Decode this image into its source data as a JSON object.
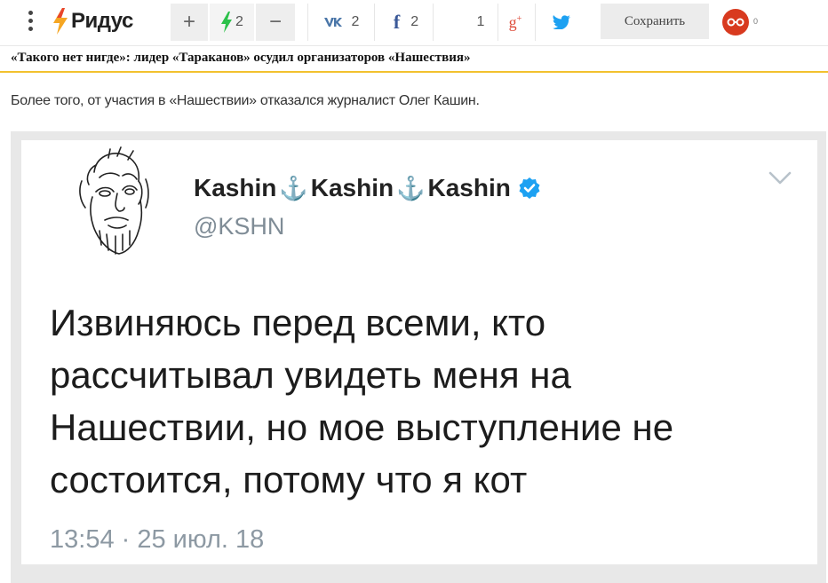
{
  "toolbar": {
    "logo_text": "Ридус",
    "vote_plus": "+",
    "vote_count": "2",
    "vote_minus": "−",
    "vk_count": "2",
    "fb_count": "2",
    "ok_count": "1",
    "save_label": "Сохранить",
    "read_later_count": "0",
    "colors": {
      "brand_orange": "#f5a623",
      "lightning_green": "#2cc14a",
      "vk_blue": "#4a76a8",
      "fb_blue": "#3b5998",
      "gplus_red": "#dd4b39",
      "twitter_blue": "#1da1f2",
      "readlater_red": "#d83a1f"
    }
  },
  "headline": {
    "link_text": "«Такого нет нигде»: лидер «Тараканов» осудил организаторов «Нашествия»",
    "underline_color": "#f2c12e"
  },
  "article": {
    "paragraph": "Более того, от участия в «Нашествии» отказался журналист Олег Кашин."
  },
  "tweet": {
    "name_parts": [
      "Kashin",
      "Kashin",
      "Kashin"
    ],
    "anchor_glyph": "⚓",
    "handle": "@KSHN",
    "lines": [
      "Извиняюсь перед всеми, кто",
      "рассчитывал увидеть меня на",
      "Нашествии, но мое выступление не",
      "состоится, потому что я кот"
    ],
    "timestamp": "13:54 · 25 июл. 18",
    "icons": [
      "verified-icon",
      "chevron-down-icon"
    ]
  }
}
